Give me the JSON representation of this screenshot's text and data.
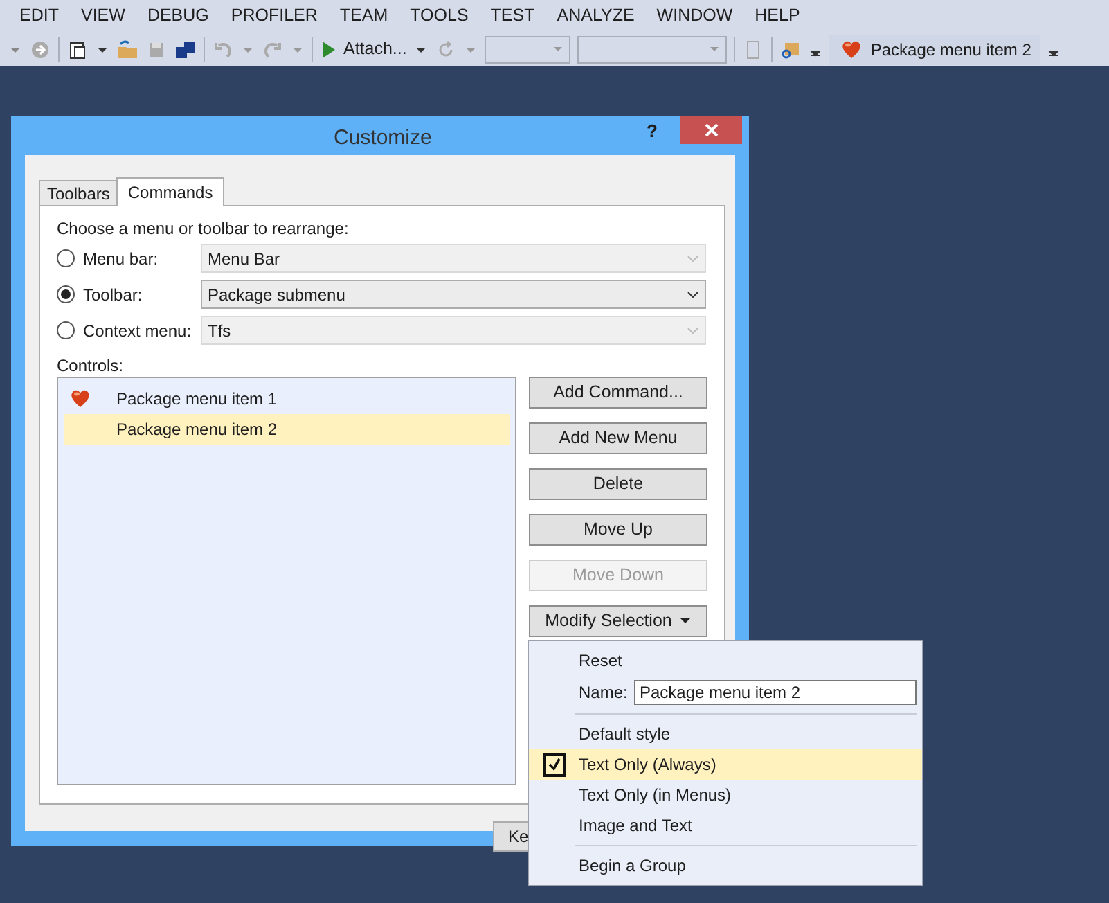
{
  "menu_bar": [
    "EDIT",
    "VIEW",
    "DEBUG",
    "PROFILER",
    "TEAM",
    "TOOLS",
    "TEST",
    "ANALYZE",
    "WINDOW",
    "HELP"
  ],
  "toolbar": {
    "attach_label": "Attach...",
    "package_button": "Package menu item 2"
  },
  "dialog": {
    "title": "Customize",
    "help": "?",
    "tabs": [
      {
        "label": "Toolbars",
        "selected": false
      },
      {
        "label": "Commands",
        "selected": true
      }
    ],
    "prompt": "Choose a menu or toolbar to rearrange:",
    "targets": [
      {
        "label": "Menu bar:",
        "selected": false,
        "value": "Menu Bar",
        "disabled": true
      },
      {
        "label": "Toolbar:",
        "selected": true,
        "value": "Package submenu",
        "disabled": false
      },
      {
        "label": "Context menu:",
        "selected": false,
        "value": "Tfs",
        "disabled": true
      }
    ],
    "controls_label": "Controls:",
    "controls": [
      {
        "label": "Package menu item 1",
        "kind": "icon",
        "selected": false
      },
      {
        "label": "Package menu item 2",
        "kind": "text",
        "selected": true
      }
    ],
    "buttons": [
      {
        "label": "Add Command...",
        "disabled": false
      },
      {
        "label": "Add New Menu",
        "disabled": false
      },
      {
        "label": "Delete",
        "disabled": false
      },
      {
        "label": "Move Up",
        "disabled": false
      },
      {
        "label": "Move Down",
        "disabled": true
      }
    ],
    "modify_button": "Modify Selection",
    "bottom_button": "Ke"
  },
  "popup_menu": [
    {
      "kind": "action",
      "label": "Reset"
    },
    {
      "kind": "field",
      "label": "Name:",
      "value": "Package menu item 2"
    },
    {
      "kind": "separator"
    },
    {
      "kind": "option",
      "label": "Default style",
      "checked": false
    },
    {
      "kind": "option",
      "label": "Text Only (Always)",
      "checked": true
    },
    {
      "kind": "option",
      "label": "Text Only (in Menus)",
      "checked": false
    },
    {
      "kind": "option",
      "label": "Image and Text",
      "checked": false
    },
    {
      "kind": "separator"
    },
    {
      "kind": "action",
      "label": "Begin a Group"
    }
  ]
}
